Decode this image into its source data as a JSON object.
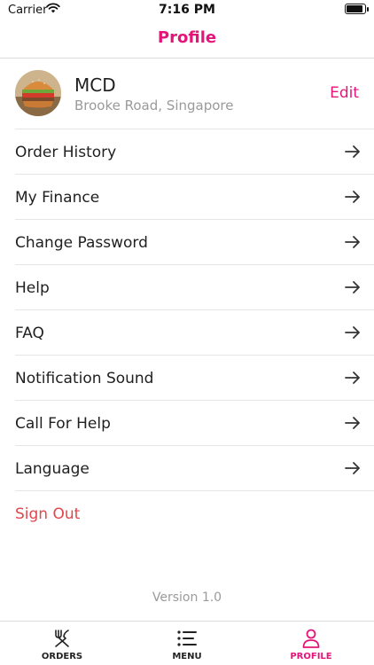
{
  "status_bar": {
    "carrier": "Carrier",
    "time": "7:16 PM"
  },
  "header": {
    "title": "Profile",
    "accent": "#e5147a"
  },
  "profile": {
    "name": "MCD",
    "address": "Brooke Road, Singapore",
    "edit_label": "Edit",
    "avatar_icon": "burger-avatar"
  },
  "menu": {
    "items": [
      {
        "label": "Order History"
      },
      {
        "label": "My Finance"
      },
      {
        "label": "Change Password"
      },
      {
        "label": "Help"
      },
      {
        "label": "FAQ"
      },
      {
        "label": "Notification Sound"
      },
      {
        "label": "Call For Help"
      },
      {
        "label": "Language"
      }
    ],
    "sign_out_label": "Sign Out",
    "sign_out_color": "#e0464a"
  },
  "footer": {
    "version": "Version 1.0"
  },
  "tab_bar": {
    "tabs": [
      {
        "label": "ORDERS",
        "icon": "fork-knife-icon",
        "active": false
      },
      {
        "label": "MENU",
        "icon": "list-icon",
        "active": false
      },
      {
        "label": "PROFILE",
        "icon": "person-icon",
        "active": true
      }
    ]
  }
}
